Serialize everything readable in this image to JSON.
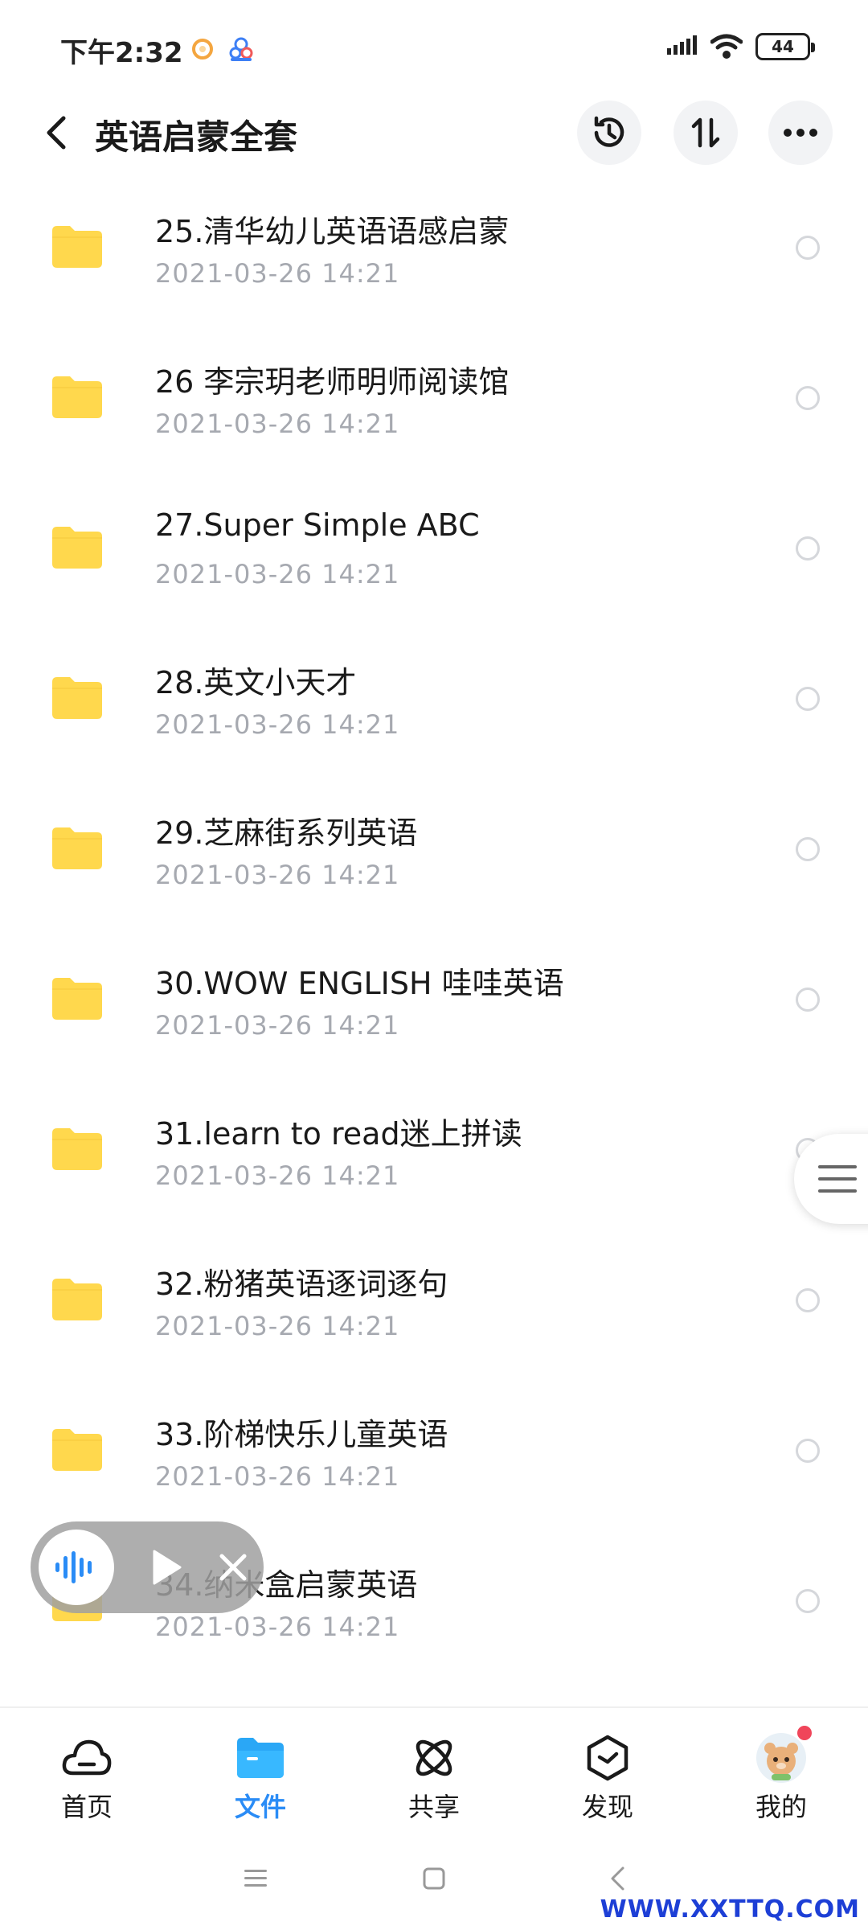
{
  "status_bar": {
    "time": "下午2:32",
    "battery": "44"
  },
  "header": {
    "title": "英语启蒙全套"
  },
  "files": [
    {
      "name": "25.清华幼儿英语语感启蒙",
      "date": "2021-03-26  14:21"
    },
    {
      "name": "26 李宗玥老师明师阅读馆",
      "date": "2021-03-26  14:21"
    },
    {
      "name": "27.Super Simple ABC",
      "date": "2021-03-26  14:21"
    },
    {
      "name": "28.英文小天才",
      "date": "2021-03-26  14:21"
    },
    {
      "name": "29.芝麻街系列英语",
      "date": "2021-03-26  14:21"
    },
    {
      "name": "30.WOW ENGLISH 哇哇英语",
      "date": "2021-03-26  14:21"
    },
    {
      "name": "31.learn to read迷上拼读",
      "date": "2021-03-26  14:21"
    },
    {
      "name": "32.粉猪英语逐词逐句",
      "date": "2021-03-26  14:21"
    },
    {
      "name": "33.阶梯快乐儿童英语",
      "date": "2021-03-26  14:21"
    },
    {
      "name": "34.纳米盒启蒙英语",
      "date": "2021-03-26  14:21"
    }
  ],
  "tabs": [
    {
      "label": "首页",
      "icon": "cloud-icon"
    },
    {
      "label": "文件",
      "icon": "folder-icon"
    },
    {
      "label": "共享",
      "icon": "share-atom-icon"
    },
    {
      "label": "发现",
      "icon": "discover-box-icon"
    },
    {
      "label": "我的",
      "icon": "avatar-icon"
    }
  ],
  "watermark": "WWW.XXTTQ.COM",
  "colors": {
    "accent": "#2a8cf6",
    "folder": "#ffd84d",
    "date_text": "#a6a9b0",
    "notification": "#f0455a"
  }
}
